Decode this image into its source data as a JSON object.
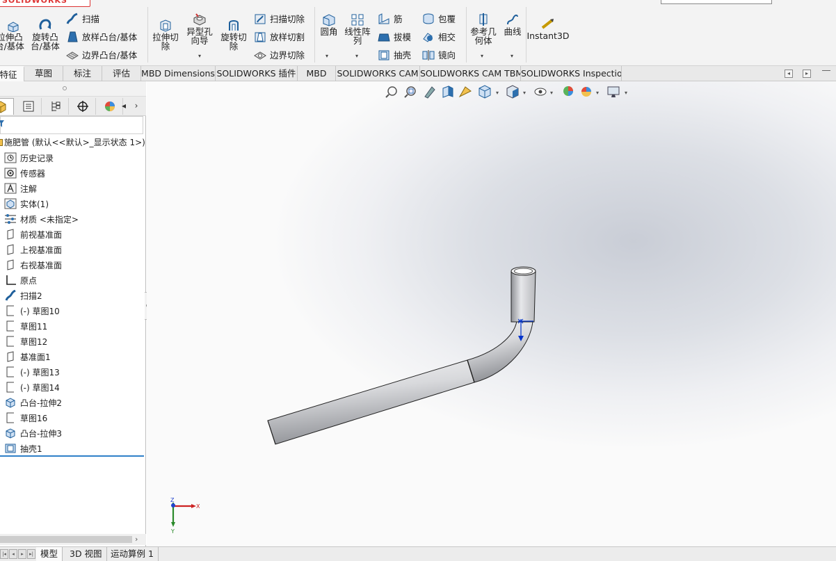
{
  "app": {
    "logo": "SOLIDWORKS"
  },
  "ribbon": {
    "extrude_boss": "拉伸凸\n台/基体",
    "revolve_boss": "旋转凸\n台/基体",
    "sweep": "扫描",
    "loft_boss": "放样凸台/基体",
    "boundary_boss": "边界凸台/基体",
    "extrude_cut": "拉伸切\n除",
    "hole_wizard": "异型孔\n向导",
    "revolve_cut": "旋转切\n除",
    "swept_cut": "扫描切除",
    "lofted_cut": "放样切割",
    "boundary_cut": "边界切除",
    "fillet": "圆角",
    "linear_pattern": "线性阵\n列",
    "rib": "筋",
    "draft": "拔模",
    "shell": "抽壳",
    "wrap": "包覆",
    "intersect": "相交",
    "mirror": "镜向",
    "ref_geometry": "参考几\n何体",
    "curves": "曲线",
    "instant3d": "Instant3D"
  },
  "tabs": [
    {
      "label": "特征"
    },
    {
      "label": "草图"
    },
    {
      "label": "标注"
    },
    {
      "label": "评估"
    },
    {
      "label": "MBD Dimensions"
    },
    {
      "label": "SOLIDWORKS 插件"
    },
    {
      "label": "MBD"
    },
    {
      "label": "SOLIDWORKS CAM"
    },
    {
      "label": "SOLIDWORKS CAM TBM"
    },
    {
      "label": "SOLIDWORKS Inspection"
    }
  ],
  "tree": {
    "root": "施肥管  (默认<<默认>_显示状态 1>)",
    "items": [
      {
        "label": "历史记录",
        "icon": "history-icon"
      },
      {
        "label": "传感器",
        "icon": "sensor-icon"
      },
      {
        "label": "注解",
        "icon": "annotation-icon"
      },
      {
        "label": "实体(1)",
        "icon": "solid-body-icon"
      },
      {
        "label": "材质 <未指定>",
        "icon": "material-icon"
      },
      {
        "label": "前视基准面",
        "icon": "plane-icon"
      },
      {
        "label": "上视基准面",
        "icon": "plane-icon"
      },
      {
        "label": "右视基准面",
        "icon": "plane-icon"
      },
      {
        "label": "原点",
        "icon": "origin-icon"
      },
      {
        "label": "扫描2",
        "icon": "sweep-icon"
      },
      {
        "label": "(-) 草图10",
        "icon": "sketch-icon"
      },
      {
        "label": "草图11",
        "icon": "sketch-icon"
      },
      {
        "label": "草图12",
        "icon": "sketch-icon"
      },
      {
        "label": "基准面1",
        "icon": "plane-icon"
      },
      {
        "label": "(-) 草图13",
        "icon": "sketch-icon"
      },
      {
        "label": "(-) 草图14",
        "icon": "sketch-icon"
      },
      {
        "label": "凸台-拉伸2",
        "icon": "extrude-icon"
      },
      {
        "label": "草图16",
        "icon": "sketch-icon"
      },
      {
        "label": "凸台-拉伸3",
        "icon": "extrude-icon"
      },
      {
        "label": "抽壳1",
        "icon": "shell-icon"
      }
    ]
  },
  "triad": {
    "x": "X",
    "y": "Y",
    "z": "Z"
  },
  "bottom_tabs": [
    {
      "label": "模型"
    },
    {
      "label": "3D 视图"
    },
    {
      "label": "运动算例 1"
    }
  ]
}
